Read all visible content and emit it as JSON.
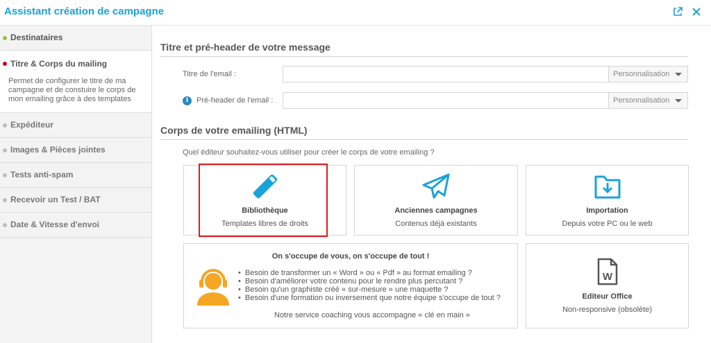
{
  "header": {
    "title": "Assistant création de campagne",
    "icons": [
      "external-link-icon",
      "close-icon"
    ],
    "accent": "#1aa3d9"
  },
  "sidebar": {
    "steps": [
      {
        "label": "Destinataires",
        "state": "done"
      },
      {
        "label": "Titre & Corps du mailing",
        "state": "active",
        "description": "Permet de configurer le titre de ma campagne et de constuire le corps de mon emailing grâce à des templates"
      },
      {
        "label": "Expéditeur",
        "state": "todo"
      },
      {
        "label": "Images & Pièces jointes",
        "state": "todo"
      },
      {
        "label": "Tests anti-spam",
        "state": "todo"
      },
      {
        "label": "Recevoir un Test / BAT",
        "state": "todo"
      },
      {
        "label": "Date & Vitesse d'envoi",
        "state": "todo"
      }
    ]
  },
  "section1": {
    "title": "Titre et pré-header de votre message",
    "subject_label": "Titre de l'email :",
    "subject_value": "",
    "preheader_label": "Pré-header de l'email :",
    "preheader_value": "",
    "perso_label": "Personnalisation"
  },
  "section2": {
    "title": "Corps de votre emailing (HTML)",
    "question": "Quel éditeur souhaitez-vous utiliser pour créer le corps de votre emailing ?",
    "cards": {
      "library": {
        "title": "Bibliothèque",
        "subtitle": "Templates libres de droits",
        "icon": "pencil-icon"
      },
      "previous": {
        "title": "Anciennes campagnes",
        "subtitle": "Contenus déjà existants",
        "icon": "paper-plane-icon"
      },
      "import": {
        "title": "Importation",
        "subtitle": "Depuis votre PC ou le web",
        "icon": "folder-download-icon"
      },
      "office": {
        "title": "Editeur Office",
        "subtitle": "Non-responsive (obsolète)",
        "icon": "word-file-icon"
      }
    },
    "coaching": {
      "title": "On s'occupe de vous, on s'occupe de tout !",
      "bullets": [
        "Besoin de transformer un « Word » ou « Pdf » au format emailing ?",
        "Besoin d'améliorer votre contenu pour le rendre plus percutant ?",
        "Besoin qu'un graphiste créé « sur-mesure » une maquette ?",
        "Besoin d'une formation ou inversement que notre équipe s'occupe de tout ?"
      ],
      "footer": "Notre service coaching vous accompagne « clé en main »",
      "icon": "headset-agent-icon"
    },
    "icon_color": "#1aa3d9",
    "highlight_color": "#e0191f"
  }
}
